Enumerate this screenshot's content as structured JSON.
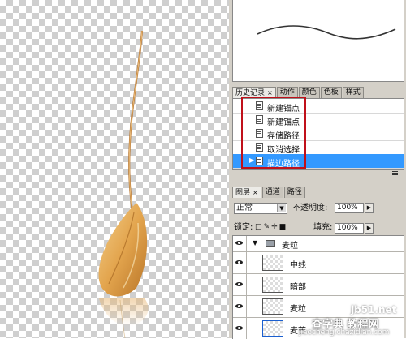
{
  "history_panel": {
    "tabs": [
      "历史记录",
      "动作",
      "颜色",
      "色板",
      "样式"
    ],
    "close_glyph": "×",
    "items": [
      {
        "label": "新建锚点",
        "selected": false
      },
      {
        "label": "新建锚点",
        "selected": false
      },
      {
        "label": "存储路径",
        "selected": false
      },
      {
        "label": "取消选择",
        "selected": false
      },
      {
        "label": "描边路径",
        "selected": true
      }
    ],
    "highlight_color": "#c0101a"
  },
  "layers_panel": {
    "tabs": [
      "图层",
      "通道",
      "路径"
    ],
    "close_glyph": "×",
    "blend_mode": "正常",
    "opacity_label": "不透明度:",
    "opacity_value": "100%",
    "lock_label": "锁定:",
    "fill_label": "填充:",
    "fill_value": "100%",
    "group": {
      "name": "麦粒",
      "expanded": true
    },
    "layers": [
      {
        "name": "中线"
      },
      {
        "name": "暗部"
      },
      {
        "name": "麦粒"
      },
      {
        "name": "麦芒"
      }
    ]
  },
  "watermark": {
    "site": "jb51.net",
    "text": "查字典 教程网",
    "url": "jiaocheng.chazidian.com"
  },
  "colors": {
    "selection": "#3399ff",
    "panel_bg": "#d4d0c8"
  }
}
